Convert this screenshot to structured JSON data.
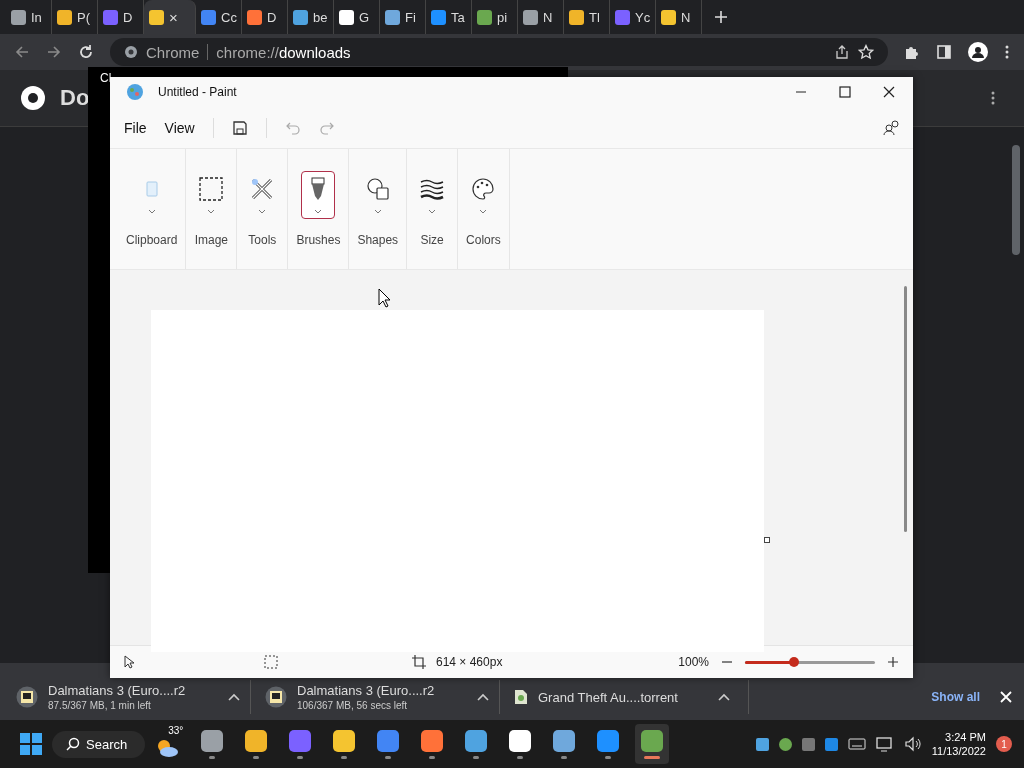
{
  "browser": {
    "tabs": [
      {
        "label": "In",
        "selected": false
      },
      {
        "label": "P(",
        "selected": false
      },
      {
        "label": "D",
        "selected": false
      },
      {
        "selected": true,
        "close": "×"
      },
      {
        "label": "Cc",
        "selected": false
      },
      {
        "label": "D",
        "selected": false
      },
      {
        "label": "be",
        "selected": false
      },
      {
        "label": "G",
        "selected": false
      },
      {
        "label": "Fi",
        "selected": false
      },
      {
        "label": "Ta",
        "selected": false
      },
      {
        "label": "pi",
        "selected": false
      },
      {
        "label": "N",
        "selected": false
      },
      {
        "label": "Tl",
        "selected": false
      },
      {
        "label": "Yc",
        "selected": false
      },
      {
        "label": "N",
        "selected": false
      }
    ],
    "address": {
      "site": "Chrome",
      "scheme": "chrome://",
      "path": "downloads"
    },
    "page_title": "Do",
    "behind_window_title": "Cl"
  },
  "paint": {
    "title": "Untitled - Paint",
    "menu": [
      "File",
      "View"
    ],
    "ribbon": [
      {
        "kind": "clipboard",
        "label": "Clipboard",
        "selected": false
      },
      {
        "kind": "image",
        "label": "Image",
        "selected": false
      },
      {
        "kind": "tools",
        "label": "Tools",
        "selected": false
      },
      {
        "kind": "brushes",
        "label": "Brushes",
        "selected": true
      },
      {
        "kind": "shapes",
        "label": "Shapes",
        "selected": false
      },
      {
        "kind": "size",
        "label": "Size",
        "selected": false
      },
      {
        "kind": "colors",
        "label": "Colors",
        "selected": false
      }
    ],
    "status": {
      "canvas_size": "614 × 460px",
      "zoom": "100%",
      "zoom_level": {
        "level": 0.38
      }
    }
  },
  "downloads": {
    "items": [
      {
        "name": "Dalmatians 3 (Euro....r2",
        "status": "87.5/367 MB, 1 min left"
      },
      {
        "name": "Dalmatians 3 (Euro....r2",
        "status": "106/367 MB, 56 secs left"
      },
      {
        "name": "Grand Theft Au....torrent"
      }
    ],
    "show_all": "Show all"
  },
  "taskbar": {
    "search": "Search",
    "weather": "33°",
    "apps": [
      {
        "selected": false
      },
      {
        "selected": false
      },
      {
        "selected": false
      },
      {
        "selected": false
      },
      {
        "selected": false
      },
      {
        "selected": false
      },
      {
        "selected": false
      },
      {
        "selected": false
      },
      {
        "selected": false
      },
      {
        "selected": false
      },
      {
        "selected": true
      }
    ],
    "time": "3:24 PM",
    "date": "11/13/2022",
    "notifications": "1"
  }
}
